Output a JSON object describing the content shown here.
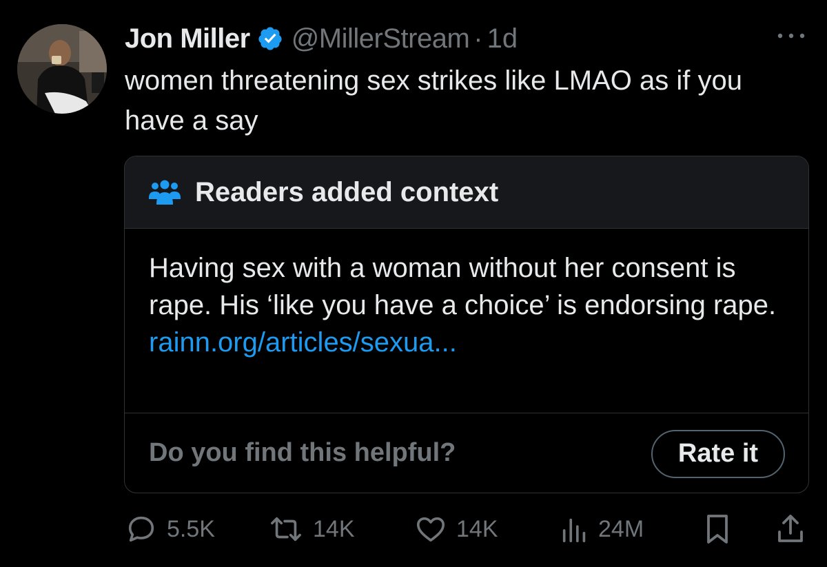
{
  "tweet": {
    "author_name": "Jon Miller",
    "handle": "@MillerStream",
    "separator": "·",
    "time": "1d",
    "text": "women threatening sex strikes like LMAO as if you have a say",
    "verified_color": "#1d9bf0"
  },
  "community_note": {
    "title": "Readers added context",
    "body": "Having sex with a woman without her consent is rape. His ‘like you have a choice’ is endorsing rape.",
    "link": "rainn.org/articles/sexua...",
    "question": "Do you find this helpful?",
    "rate_label": "Rate it",
    "accent_color": "#1d9bf0"
  },
  "actions": {
    "replies": "5.5K",
    "reposts": "14K",
    "likes": "14K",
    "views": "24M"
  },
  "icons": [
    "verified-badge-icon",
    "more-icon",
    "people-icon",
    "reply-icon",
    "repost-icon",
    "like-icon",
    "views-icon",
    "bookmark-icon",
    "share-icon"
  ]
}
